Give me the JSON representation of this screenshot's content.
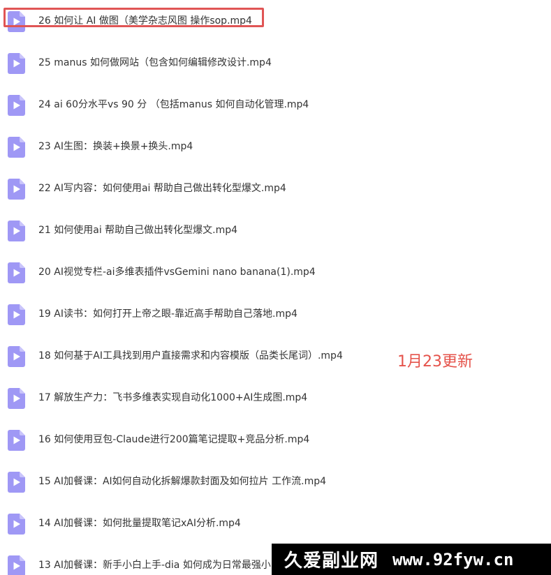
{
  "files": [
    {
      "name": "26 如何让 AI 做图（美学杂志风图 操作sop.mp4",
      "icon": "video-file-icon"
    },
    {
      "name": "25 manus 如何做网站（包含如何编辑修改设计.mp4",
      "icon": "video-file-icon"
    },
    {
      "name": "24 ai 60分水平vs 90 分 （包括manus 如何自动化管理.mp4",
      "icon": "video-file-icon"
    },
    {
      "name": "23 AI生图：换装+换景+换头.mp4",
      "icon": "video-file-icon"
    },
    {
      "name": "22 AI写内容：如何使用ai 帮助自己做出转化型爆文.mp4",
      "icon": "video-file-icon"
    },
    {
      "name": "21 如何使用ai 帮助自己做出转化型爆文.mp4",
      "icon": "video-file-icon"
    },
    {
      "name": "20 AI视觉专栏-ai多维表插件vsGemini nano banana(1).mp4",
      "icon": "video-file-icon"
    },
    {
      "name": "19 AI读书：如何打开上帝之眼-靠近高手帮助自己落地.mp4",
      "icon": "video-file-icon"
    },
    {
      "name": "18 如何基于AI工具找到用户直接需求和内容模版（品类长尾词）.mp4",
      "icon": "video-file-icon"
    },
    {
      "name": "17 解放生产力：飞书多维表实现自动化1000+AI生成图.mp4",
      "icon": "video-file-icon"
    },
    {
      "name": "16 如何使用豆包-Claude进行200篇笔记提取+竞品分析.mp4",
      "icon": "video-file-icon"
    },
    {
      "name": "15 AI加餐课：AI如何自动化拆解爆款封面及如何拉片 工作流.mp4",
      "icon": "video-file-icon"
    },
    {
      "name": "14 AI加餐课：如何批量提取笔记xAI分析.mp4",
      "icon": "video-file-icon"
    },
    {
      "name": "13 AI加餐课：新手小白上手-dia 如何成为日常最强小",
      "icon": "video-file-icon"
    }
  ],
  "update_note": "1月23更新",
  "watermark": {
    "cn": "久爱副业网",
    "url": "www.92fyw.cn"
  },
  "colors": {
    "icon_fill": "#9f98f5",
    "icon_fold": "#c9c4fb",
    "highlight": "#e05555",
    "note": "#e5534b"
  }
}
